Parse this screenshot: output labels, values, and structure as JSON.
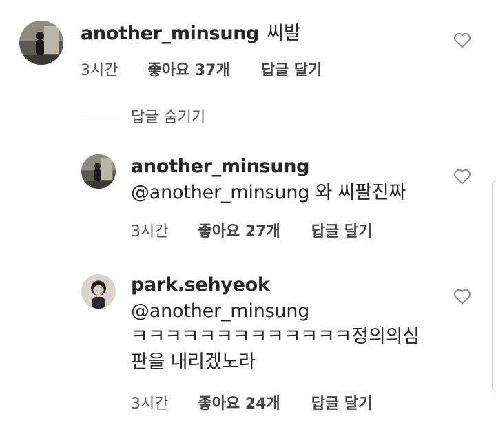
{
  "comments": [
    {
      "username": "another_minsung",
      "text": "씨발",
      "time": "3시간",
      "likes": "좋아요 37개",
      "reply": "답글 달기"
    }
  ],
  "hide_replies": "답글 숨기기",
  "replies": [
    {
      "username": "another_minsung",
      "text": "@another_minsung 와 씨팔진짜",
      "time": "3시간",
      "likes": "좋아요 27개",
      "reply": "답글 달기"
    },
    {
      "username": "park.sehyeok",
      "text_lines": [
        "@another_minsung",
        "ㅋㅋㅋㅋㅋㅋㅋㅋㅋㅋㅋㅋㅋ정의의심",
        "판을 내리겠노라"
      ],
      "time": "3시간",
      "likes": "좋아요 24개",
      "reply": "답글 달기"
    }
  ],
  "icons": {
    "heart": "heart-outline-icon"
  }
}
